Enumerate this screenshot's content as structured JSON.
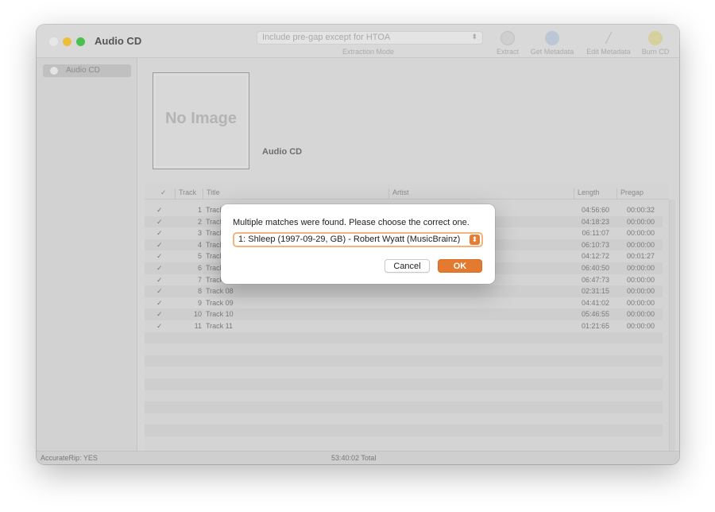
{
  "window": {
    "title": "Audio CD"
  },
  "toolbar": {
    "extraction_mode_value": "Include pre-gap except for HTOA",
    "extraction_mode_label": "Extraction Mode",
    "extract_label": "Extract",
    "get_metadata_label": "Get Metadata",
    "edit_metadata_label": "Edit Metadata",
    "burn_cd_label": "Burn CD"
  },
  "sidebar": {
    "items": [
      {
        "label": "Audio CD"
      }
    ]
  },
  "album": {
    "artwork_placeholder": "No Image",
    "title": "Audio CD"
  },
  "table": {
    "headers": {
      "check": "✓",
      "track": "Track",
      "title": "Title",
      "artist": "Artist",
      "length": "Length",
      "pregap": "Pregap"
    },
    "rows": [
      {
        "check": "✓",
        "num": "1",
        "title": "Track",
        "length": "04:56:60",
        "pregap": "00:00:32"
      },
      {
        "check": "✓",
        "num": "2",
        "title": "Track",
        "length": "04:18:23",
        "pregap": "00:00:00"
      },
      {
        "check": "✓",
        "num": "3",
        "title": "Track",
        "length": "06:11:07",
        "pregap": "00:00:00"
      },
      {
        "check": "✓",
        "num": "4",
        "title": "Track",
        "length": "06:10:73",
        "pregap": "00:00:00"
      },
      {
        "check": "✓",
        "num": "5",
        "title": "Track",
        "length": "04:12:72",
        "pregap": "00:01:27"
      },
      {
        "check": "✓",
        "num": "6",
        "title": "Track",
        "length": "06:40:50",
        "pregap": "00:00:00"
      },
      {
        "check": "✓",
        "num": "7",
        "title": "Track",
        "length": "06:47:73",
        "pregap": "00:00:00"
      },
      {
        "check": "✓",
        "num": "8",
        "title": "Track 08",
        "length": "02:31:15",
        "pregap": "00:00:00"
      },
      {
        "check": "✓",
        "num": "9",
        "title": "Track 09",
        "length": "04:41:02",
        "pregap": "00:00:00"
      },
      {
        "check": "✓",
        "num": "10",
        "title": "Track 10",
        "length": "05:46:55",
        "pregap": "00:00:00"
      },
      {
        "check": "✓",
        "num": "11",
        "title": "Track 11",
        "length": "01:21:65",
        "pregap": "00:00:00"
      }
    ]
  },
  "status": {
    "accuraterip": "AccurateRip: YES",
    "total": "53:40:02 Total"
  },
  "dialog": {
    "message": "Multiple matches were found. Please choose the correct one.",
    "selected_match": "1: Shleep (1997-09-29, GB) - Robert Wyatt (MusicBrainz)",
    "cancel_label": "Cancel",
    "ok_label": "OK"
  },
  "colors": {
    "accent": "#e37a2f",
    "focus_ring": "#f3b37e"
  },
  "icons": {
    "extract": "cd-extract-icon",
    "get_metadata": "globe-icon",
    "edit_metadata": "pencil-icon",
    "burn_cd": "radiation-icon",
    "sidebar_cd": "cd-icon"
  }
}
